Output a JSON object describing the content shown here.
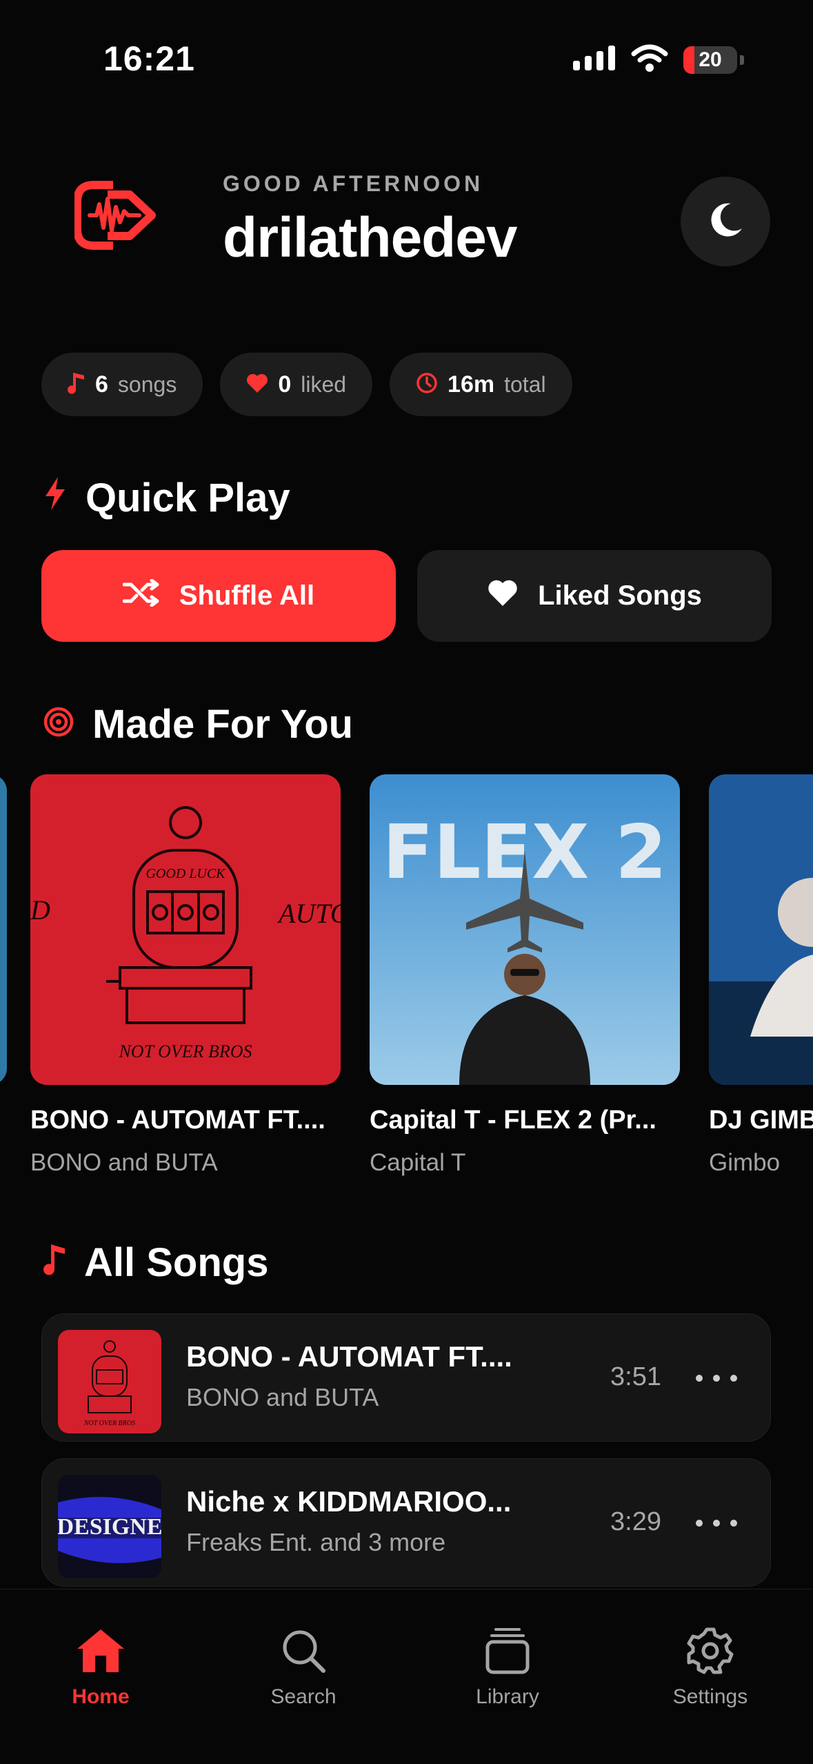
{
  "status_bar": {
    "time": "16:21",
    "battery": "20",
    "battery_level": 0.2
  },
  "header": {
    "greeting": "GOOD AFTERNOON",
    "username": "drilathedev"
  },
  "stats": [
    {
      "value": "6",
      "label": "songs",
      "icon": "music-note-icon"
    },
    {
      "value": "0",
      "label": "liked",
      "icon": "heart-icon"
    },
    {
      "value": "16m",
      "label": "total",
      "icon": "clock-icon"
    }
  ],
  "quick_play": {
    "title": "Quick Play",
    "shuffle_label": "Shuffle All",
    "liked_label": "Liked Songs"
  },
  "made_for_you": {
    "title": "Made For You",
    "cards": [
      {
        "title": "BONO - AUTOMAT FT....",
        "artist": "BONO and BUTA"
      },
      {
        "title": "Capital T - FLEX 2 (Pr...",
        "artist": "Capital T"
      },
      {
        "title": "DJ GIMBO",
        "artist": "Gimbo"
      }
    ]
  },
  "all_songs": {
    "title": "All Songs",
    "items": [
      {
        "title": "BONO - AUTOMAT FT....",
        "artist": "BONO and BUTA",
        "duration": "3:51"
      },
      {
        "title": "Niche x KIDDMARIOO...",
        "artist": "Freaks Ent. and 3 more",
        "duration": "3:29"
      }
    ]
  },
  "tab_bar": {
    "items": [
      {
        "label": "Home",
        "icon": "home-icon",
        "active": true
      },
      {
        "label": "Search",
        "icon": "search-icon",
        "active": false
      },
      {
        "label": "Library",
        "icon": "library-icon",
        "active": false
      },
      {
        "label": "Settings",
        "icon": "settings-icon",
        "active": false
      }
    ]
  },
  "colors": {
    "accent": "#ff3434",
    "background": "#060606",
    "surface": "#1c1c1c"
  }
}
